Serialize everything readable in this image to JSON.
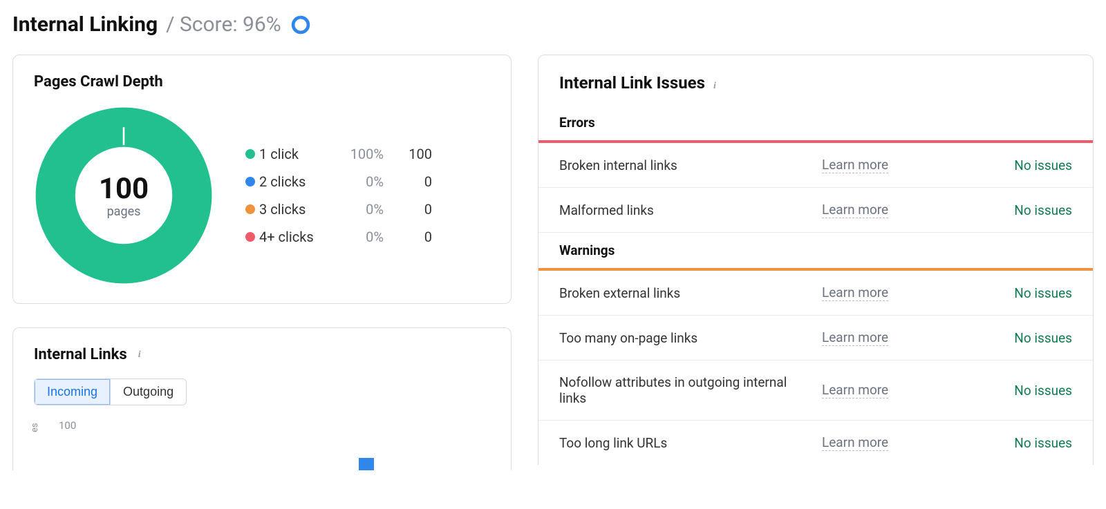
{
  "header": {
    "title": "Internal Linking",
    "score_label": "/ Score: 96%",
    "score_value": 96
  },
  "crawl_depth": {
    "title": "Pages Crawl Depth",
    "total_value": "100",
    "total_label": "pages",
    "legend": [
      {
        "label": "1 click",
        "pct": "100%",
        "count": "100",
        "color": "#22c08f"
      },
      {
        "label": "2 clicks",
        "pct": "0%",
        "count": "0",
        "color": "#2f86eb"
      },
      {
        "label": "3 clicks",
        "pct": "0%",
        "count": "0",
        "color": "#f0933f"
      },
      {
        "label": "4+ clicks",
        "pct": "0%",
        "count": "0",
        "color": "#ef5b6a"
      }
    ]
  },
  "chart_data": {
    "type": "pie",
    "title": "Pages Crawl Depth",
    "categories": [
      "1 click",
      "2 clicks",
      "3 clicks",
      "4+ clicks"
    ],
    "values": [
      100,
      0,
      0,
      0
    ],
    "percentages": [
      100,
      0,
      0,
      0
    ],
    "colors": [
      "#22c08f",
      "#2f86eb",
      "#f0933f",
      "#ef5b6a"
    ],
    "center_value": 100,
    "center_label": "pages"
  },
  "internal_links": {
    "title": "Internal Links",
    "tabs": [
      "Incoming",
      "Outgoing"
    ],
    "active_tab": 0,
    "y_axis_label": "es",
    "y_tick": "100"
  },
  "issues": {
    "title": "Internal Link Issues",
    "learn_more_label": "Learn more",
    "no_issues_label": "No issues",
    "sections": [
      {
        "name": "Errors",
        "color": "red",
        "items": [
          {
            "name": "Broken internal links",
            "status": "No issues"
          },
          {
            "name": "Malformed links",
            "status": "No issues"
          }
        ]
      },
      {
        "name": "Warnings",
        "color": "orange",
        "items": [
          {
            "name": "Broken external links",
            "status": "No issues"
          },
          {
            "name": "Too many on-page links",
            "status": "No issues"
          },
          {
            "name": "Nofollow attributes in outgoing internal links",
            "status": "No issues"
          },
          {
            "name": "Too long link URLs",
            "status": "No issues"
          }
        ]
      }
    ]
  }
}
